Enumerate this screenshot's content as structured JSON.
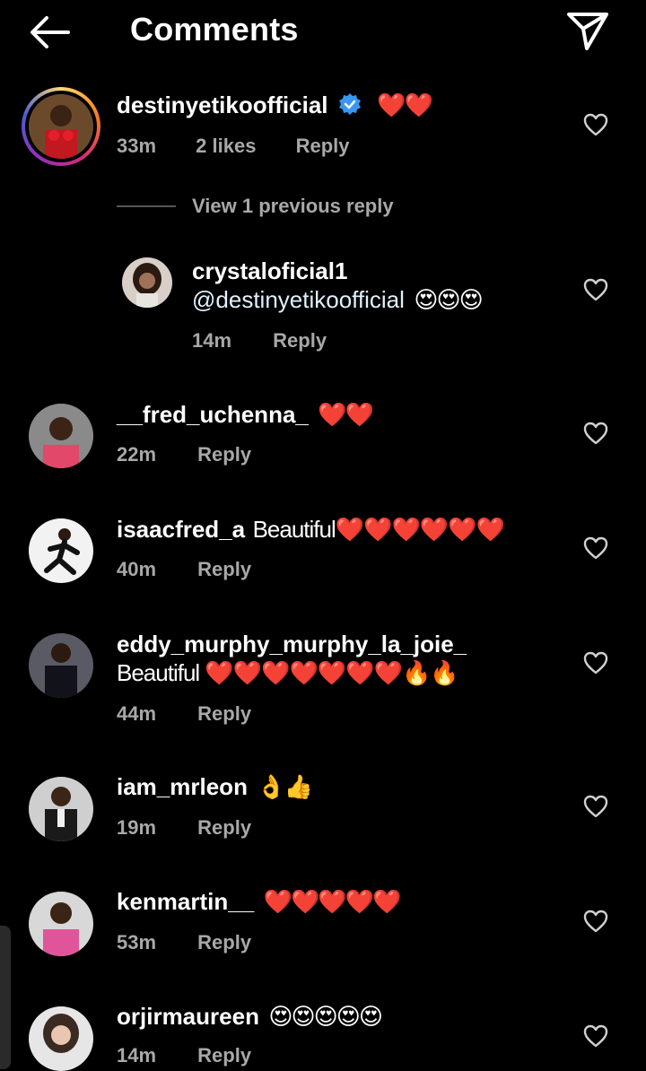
{
  "header": {
    "title": "Comments"
  },
  "view_previous": "View 1 previous reply",
  "main_comment": {
    "username": "destinyetikoofficial",
    "text": "❤️❤️",
    "time": "33m",
    "likes": "2 likes",
    "reply": "Reply"
  },
  "reply_comment": {
    "username": "crystaloficial1",
    "mention": "@destinyetikoofficial",
    "emoji": "😍😍😍",
    "time": "14m",
    "reply": "Reply"
  },
  "comments": [
    {
      "username": "__fred_uchenna_",
      "text": "❤️❤️",
      "time": "22m",
      "reply": "Reply"
    },
    {
      "username": "isaacfred_a",
      "text": "Beautiful❤️❤️❤️❤️❤️❤️",
      "time": "40m",
      "reply": "Reply"
    },
    {
      "username": "eddy_murphy_murphy_la_joie_",
      "text": "Beautiful ❤️❤️❤️❤️❤️❤️❤️🔥🔥",
      "time": "44m",
      "reply": "Reply"
    },
    {
      "username": "iam_mrleon",
      "text": "👌👍",
      "time": "19m",
      "reply": "Reply"
    },
    {
      "username": "kenmartin__",
      "text": "❤️❤️❤️❤️❤️",
      "time": "53m",
      "reply": "Reply"
    },
    {
      "username": "orjirmaureen",
      "text": "😍😍😍😍😍",
      "time": "14m",
      "reply": "Reply"
    }
  ],
  "colors": {
    "background": "#000000",
    "text": "#ffffff",
    "secondary": "#a8a8a8",
    "verified": "#3897f0"
  }
}
